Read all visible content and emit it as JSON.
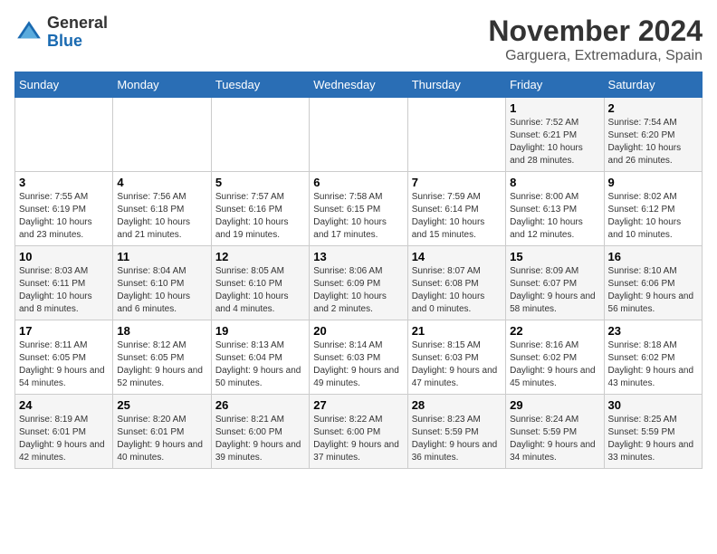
{
  "logo": {
    "general": "General",
    "blue": "Blue"
  },
  "title": "November 2024",
  "location": "Garguera, Extremadura, Spain",
  "days_of_week": [
    "Sunday",
    "Monday",
    "Tuesday",
    "Wednesday",
    "Thursday",
    "Friday",
    "Saturday"
  ],
  "weeks": [
    [
      {
        "day": "",
        "info": ""
      },
      {
        "day": "",
        "info": ""
      },
      {
        "day": "",
        "info": ""
      },
      {
        "day": "",
        "info": ""
      },
      {
        "day": "",
        "info": ""
      },
      {
        "day": "1",
        "info": "Sunrise: 7:52 AM\nSunset: 6:21 PM\nDaylight: 10 hours and 28 minutes."
      },
      {
        "day": "2",
        "info": "Sunrise: 7:54 AM\nSunset: 6:20 PM\nDaylight: 10 hours and 26 minutes."
      }
    ],
    [
      {
        "day": "3",
        "info": "Sunrise: 7:55 AM\nSunset: 6:19 PM\nDaylight: 10 hours and 23 minutes."
      },
      {
        "day": "4",
        "info": "Sunrise: 7:56 AM\nSunset: 6:18 PM\nDaylight: 10 hours and 21 minutes."
      },
      {
        "day": "5",
        "info": "Sunrise: 7:57 AM\nSunset: 6:16 PM\nDaylight: 10 hours and 19 minutes."
      },
      {
        "day": "6",
        "info": "Sunrise: 7:58 AM\nSunset: 6:15 PM\nDaylight: 10 hours and 17 minutes."
      },
      {
        "day": "7",
        "info": "Sunrise: 7:59 AM\nSunset: 6:14 PM\nDaylight: 10 hours and 15 minutes."
      },
      {
        "day": "8",
        "info": "Sunrise: 8:00 AM\nSunset: 6:13 PM\nDaylight: 10 hours and 12 minutes."
      },
      {
        "day": "9",
        "info": "Sunrise: 8:02 AM\nSunset: 6:12 PM\nDaylight: 10 hours and 10 minutes."
      }
    ],
    [
      {
        "day": "10",
        "info": "Sunrise: 8:03 AM\nSunset: 6:11 PM\nDaylight: 10 hours and 8 minutes."
      },
      {
        "day": "11",
        "info": "Sunrise: 8:04 AM\nSunset: 6:10 PM\nDaylight: 10 hours and 6 minutes."
      },
      {
        "day": "12",
        "info": "Sunrise: 8:05 AM\nSunset: 6:10 PM\nDaylight: 10 hours and 4 minutes."
      },
      {
        "day": "13",
        "info": "Sunrise: 8:06 AM\nSunset: 6:09 PM\nDaylight: 10 hours and 2 minutes."
      },
      {
        "day": "14",
        "info": "Sunrise: 8:07 AM\nSunset: 6:08 PM\nDaylight: 10 hours and 0 minutes."
      },
      {
        "day": "15",
        "info": "Sunrise: 8:09 AM\nSunset: 6:07 PM\nDaylight: 9 hours and 58 minutes."
      },
      {
        "day": "16",
        "info": "Sunrise: 8:10 AM\nSunset: 6:06 PM\nDaylight: 9 hours and 56 minutes."
      }
    ],
    [
      {
        "day": "17",
        "info": "Sunrise: 8:11 AM\nSunset: 6:05 PM\nDaylight: 9 hours and 54 minutes."
      },
      {
        "day": "18",
        "info": "Sunrise: 8:12 AM\nSunset: 6:05 PM\nDaylight: 9 hours and 52 minutes."
      },
      {
        "day": "19",
        "info": "Sunrise: 8:13 AM\nSunset: 6:04 PM\nDaylight: 9 hours and 50 minutes."
      },
      {
        "day": "20",
        "info": "Sunrise: 8:14 AM\nSunset: 6:03 PM\nDaylight: 9 hours and 49 minutes."
      },
      {
        "day": "21",
        "info": "Sunrise: 8:15 AM\nSunset: 6:03 PM\nDaylight: 9 hours and 47 minutes."
      },
      {
        "day": "22",
        "info": "Sunrise: 8:16 AM\nSunset: 6:02 PM\nDaylight: 9 hours and 45 minutes."
      },
      {
        "day": "23",
        "info": "Sunrise: 8:18 AM\nSunset: 6:02 PM\nDaylight: 9 hours and 43 minutes."
      }
    ],
    [
      {
        "day": "24",
        "info": "Sunrise: 8:19 AM\nSunset: 6:01 PM\nDaylight: 9 hours and 42 minutes."
      },
      {
        "day": "25",
        "info": "Sunrise: 8:20 AM\nSunset: 6:01 PM\nDaylight: 9 hours and 40 minutes."
      },
      {
        "day": "26",
        "info": "Sunrise: 8:21 AM\nSunset: 6:00 PM\nDaylight: 9 hours and 39 minutes."
      },
      {
        "day": "27",
        "info": "Sunrise: 8:22 AM\nSunset: 6:00 PM\nDaylight: 9 hours and 37 minutes."
      },
      {
        "day": "28",
        "info": "Sunrise: 8:23 AM\nSunset: 5:59 PM\nDaylight: 9 hours and 36 minutes."
      },
      {
        "day": "29",
        "info": "Sunrise: 8:24 AM\nSunset: 5:59 PM\nDaylight: 9 hours and 34 minutes."
      },
      {
        "day": "30",
        "info": "Sunrise: 8:25 AM\nSunset: 5:59 PM\nDaylight: 9 hours and 33 minutes."
      }
    ]
  ]
}
